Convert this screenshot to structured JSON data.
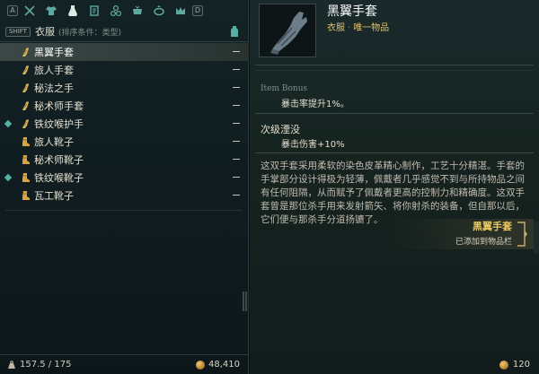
{
  "tabs": {
    "left_key": "A",
    "right_key": "D",
    "icons": [
      "crossed-swords-icon",
      "shirt-icon",
      "potion-icon",
      "scroll-icon",
      "gem-cluster-icon",
      "cauldron-icon",
      "ring-icon",
      "crown-icon"
    ]
  },
  "category": {
    "shift_key": "SHIFT",
    "label": "衣服",
    "sort_hint": "(排序条件：类型)"
  },
  "inventory": {
    "items": [
      {
        "name": "黑翼手套",
        "kind": "glove",
        "marked": false,
        "selected": true
      },
      {
        "name": "旅人手套",
        "kind": "glove",
        "marked": false,
        "selected": false
      },
      {
        "name": "秘法之手",
        "kind": "glove",
        "marked": false,
        "selected": false
      },
      {
        "name": "秘术师手套",
        "kind": "glove",
        "marked": false,
        "selected": false
      },
      {
        "name": "铁纹喉护手",
        "kind": "glove",
        "marked": true,
        "selected": false
      },
      {
        "name": "旅人靴子",
        "kind": "boot",
        "marked": false,
        "selected": false
      },
      {
        "name": "秘术师靴子",
        "kind": "boot",
        "marked": false,
        "selected": false
      },
      {
        "name": "铁纹喉靴子",
        "kind": "boot",
        "marked": true,
        "selected": false
      },
      {
        "name": "瓦工靴子",
        "kind": "boot",
        "marked": false,
        "selected": false
      }
    ],
    "weight": "157.5 / 175",
    "gold": "48,410"
  },
  "detail": {
    "title": "黑翼手套",
    "type": "衣服",
    "rarity": "唯一物品",
    "item_bonus_label": "Item Bonus",
    "item_bonus_value": "暴击率提升1%。",
    "secondary_label": "次级湮没",
    "secondary_value": "暴击伤害+10%",
    "description": "这双手套采用柔软的染色皮革精心制作，工艺十分精湛。手套的手掌部分设计得极为轻薄，佩戴者几乎感觉不到与所持物品之间有任何阻隔，从而赋予了佩戴者更高的控制力和精确度。这双手套曾是那位杀手用来发射箭矢、将你射杀的装备，但自那以后，它们便与那杀手分道扬镳了。",
    "value": "120"
  },
  "notification": {
    "name": "黑翼手套",
    "sub": "已添加到物品栏"
  },
  "colors": {
    "accent_teal": "#57b0a4",
    "rarity_gold": "#e0c070",
    "notify_gold": "#e8c860"
  }
}
